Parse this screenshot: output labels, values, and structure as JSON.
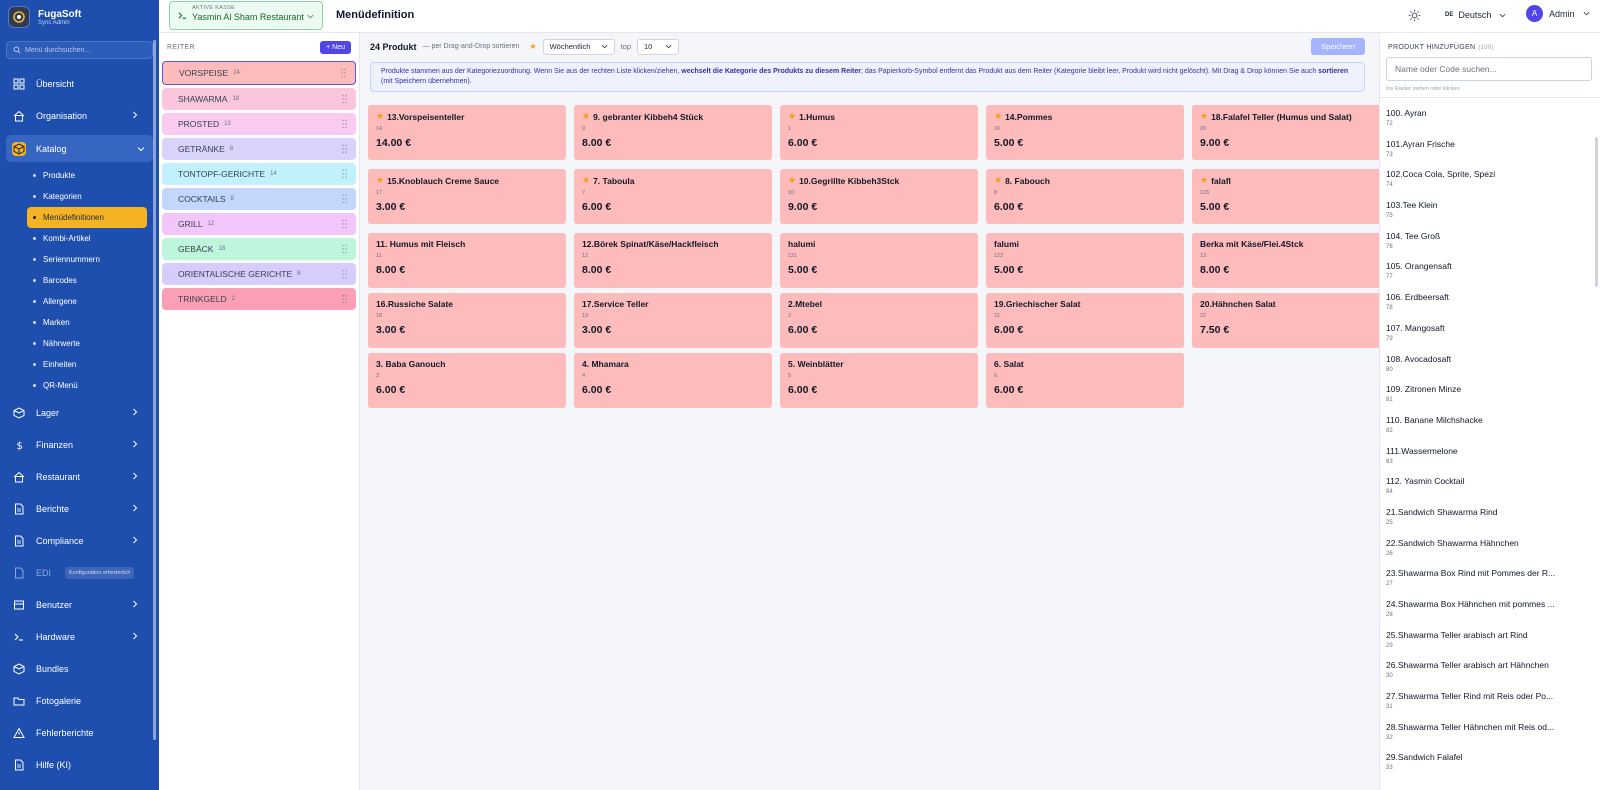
{
  "brand": {
    "title": "FugaSoft",
    "subtitle": "Sync Admin"
  },
  "sidebar": {
    "search_placeholder": "Menü durchsuchen...",
    "items_top": [
      {
        "label": "Übersicht",
        "icon": "dashboard-icon"
      },
      {
        "label": "Organisation",
        "icon": "home-icon"
      },
      {
        "label": "Katalog",
        "icon": "box-icon"
      }
    ],
    "catalog_sub": [
      {
        "label": "Produkte"
      },
      {
        "label": "Kategorien"
      },
      {
        "label": "Menüdefinitionen"
      },
      {
        "label": "Kombi-Artikel"
      },
      {
        "label": "Seriennummern"
      },
      {
        "label": "Barcodes"
      },
      {
        "label": "Allergene"
      },
      {
        "label": "Marken"
      },
      {
        "label": "Nährwerte"
      },
      {
        "label": "Einheiten"
      },
      {
        "label": "QR-Menü"
      }
    ],
    "items_bottom": [
      {
        "label": "Lager"
      },
      {
        "label": "Finanzen"
      },
      {
        "label": "Restaurant"
      },
      {
        "label": "Berichte"
      },
      {
        "label": "Compliance"
      },
      {
        "label": "EDI",
        "badge": "Konfiguration erforderlich"
      },
      {
        "label": "Benutzer"
      },
      {
        "label": "Hardware"
      },
      {
        "label": "Bundles"
      },
      {
        "label": "Fotogalerie"
      },
      {
        "label": "Fehlerberichte"
      },
      {
        "label": "Hilfe (KI)"
      }
    ]
  },
  "topbar": {
    "kasse_label": "AKTIVE KASSE",
    "kasse_value": "Yasmin Al Sham Restaurant",
    "page_title": "Menüdefinition",
    "lang_code": "DE",
    "lang_label": "Deutsch",
    "avatar_letter": "A",
    "user_label": "Admin"
  },
  "reiter": {
    "label": "REITER",
    "new_button": "+ Neu",
    "tabs": [
      {
        "name": "VORSPEISE",
        "count": "24",
        "color": "#fdbbbb"
      },
      {
        "name": "SHAWARMA",
        "count": "18",
        "color": "#fbc5dd"
      },
      {
        "name": "PROSTED",
        "count": "13",
        "color": "#fbcaf0"
      },
      {
        "name": "GETRÄNKE",
        "count": "8",
        "color": "#d9d2fb"
      },
      {
        "name": "TONTOPF-GERICHTE",
        "count": "14",
        "color": "#c1f1fc"
      },
      {
        "name": "COCKTAILS",
        "count": "8",
        "color": "#c3d6fc"
      },
      {
        "name": "GRILL",
        "count": "12",
        "color": "#f2c5fb"
      },
      {
        "name": "GEBÄCK",
        "count": "18",
        "color": "#bdf6dc"
      },
      {
        "name": "ORIENTALISCHE GERICHTE",
        "count": "8",
        "color": "#d7cdfc"
      },
      {
        "name": "TRINKGELD",
        "count": "2",
        "color": "#fb9fb4"
      }
    ]
  },
  "toolbar": {
    "count": "24 Produkt",
    "hint": "— per Drag-and-Drop sortieren",
    "period": "Wöchentlich",
    "top_label": "top",
    "top_value": "10",
    "save": "Speichern"
  },
  "info": {
    "part1": "Produkte stammen aus der Kategoriezuordnung. Wenn Sie aus der rechten Liste klicken/ziehen, ",
    "bold1": "wechselt die Kategorie des Produkts zu diesem Reiter",
    "part2": "; das Papierkorb-Symbol entfernt das Produkt aus dem Reiter (Kategorie bleibt leer, Produkt wird nicht gelöscht). Mit Drag & Drop können Sie auch ",
    "bold2": "sortieren",
    "part3": " (mit Speichern übernehmen)."
  },
  "products": [
    {
      "name": "13.Vorspeisenteller",
      "id": "14",
      "price": "14.00 €",
      "star": true
    },
    {
      "name": "9. gebranter Kibbeh4 Stück",
      "id": "9",
      "price": "8.00 €",
      "star": true
    },
    {
      "name": "1.Humus",
      "id": "1",
      "price": "6.00 €",
      "star": true
    },
    {
      "name": "14.Pommes",
      "id": "16",
      "price": "5.00 €",
      "star": true
    },
    {
      "name": "18.Falafel Teller (Humus und Salat)",
      "id": "20",
      "price": "9.00 €",
      "star": true
    },
    {
      "name": "15.Knoblauch Creme Sauce",
      "id": "17",
      "price": "3.00 €",
      "star": true
    },
    {
      "name": "7. Taboula",
      "id": "7",
      "price": "6.00 €",
      "star": true
    },
    {
      "name": "10.Gegrillte Kibbeh3Stck",
      "id": "10",
      "price": "9.00 €",
      "star": true
    },
    {
      "name": "8. Fabouch",
      "id": "8",
      "price": "6.00 €",
      "star": true
    },
    {
      "name": "falafl",
      "id": "126",
      "price": "5.00 €",
      "star": true
    },
    {
      "name": "11. Humus mit Fleisch",
      "id": "11",
      "price": "8.00 €",
      "star": false
    },
    {
      "name": "12.Börek Spinat/Käse/Hackfleisch",
      "id": "12",
      "price": "8.00 €",
      "star": false
    },
    {
      "name": "halumi",
      "id": "121",
      "price": "5.00 €",
      "star": false
    },
    {
      "name": "falumi",
      "id": "122",
      "price": "5.00 €",
      "star": false
    },
    {
      "name": "Berka mit Käse/Flei.4Stck",
      "id": "13",
      "price": "8.00 €",
      "star": false
    },
    {
      "name": "16.Russiche Salate",
      "id": "18",
      "price": "3.00 €",
      "star": false
    },
    {
      "name": "17.Service Teller",
      "id": "19",
      "price": "3.00 €",
      "star": false
    },
    {
      "name": "2.Mtebel",
      "id": "2",
      "price": "6.00 €",
      "star": false
    },
    {
      "name": "19.Griechischer Salat",
      "id": "21",
      "price": "6.00 €",
      "star": false
    },
    {
      "name": "20.Hähnchen Salat",
      "id": "22",
      "price": "7.50 €",
      "star": false
    },
    {
      "name": "3. Baba Ganouch",
      "id": "3",
      "price": "6.00 €",
      "star": false
    },
    {
      "name": "4. Mhamara",
      "id": "4",
      "price": "6.00 €",
      "star": false
    },
    {
      "name": "5. Weinblätter",
      "id": "5",
      "price": "6.00 €",
      "star": false
    },
    {
      "name": "6. Salat",
      "id": "6",
      "price": "6.00 €",
      "star": false
    }
  ],
  "right": {
    "header": "PRODUKT HINZUFÜGEN",
    "count": "(100)",
    "placeholder": "Name oder Code suchen...",
    "hint": "Ins Raster ziehen oder klicken",
    "items": [
      {
        "name": "100. Ayran",
        "id": "72"
      },
      {
        "name": "101.Ayran Frische",
        "id": "73"
      },
      {
        "name": "102.Coca Cola, Sprite, Spezi",
        "id": "74"
      },
      {
        "name": "103.Tee Klein",
        "id": "75"
      },
      {
        "name": "104. Tee Groß",
        "id": "76"
      },
      {
        "name": "105. Orangensaft",
        "id": "77"
      },
      {
        "name": "106. Erdbeersaft",
        "id": "78"
      },
      {
        "name": "107. Mangosaft",
        "id": "79"
      },
      {
        "name": "108. Avocadosaft",
        "id": "80"
      },
      {
        "name": "109. Zitronen Minze",
        "id": "81"
      },
      {
        "name": "110. Banane Milchshacke",
        "id": "82"
      },
      {
        "name": "111.Wassermelone",
        "id": "83"
      },
      {
        "name": "112. Yasmin Cocktail",
        "id": "84"
      },
      {
        "name": "21.Sandwich Shawarma Rind",
        "id": "25"
      },
      {
        "name": "22.Sandwich Shawarma Hähnchen",
        "id": "26"
      },
      {
        "name": "23.Shawarma Box Rind mit Pommes der R...",
        "id": "27"
      },
      {
        "name": "24.Shawarma Box Hähnchen mit pommes ...",
        "id": "28"
      },
      {
        "name": "25.Shawarma Teller arabisch art Rind",
        "id": "29"
      },
      {
        "name": "26.Shawarma Teller arabisch art Hähnchen",
        "id": "30"
      },
      {
        "name": "27.Shawarma Teller Rind mit Reis oder Po...",
        "id": "31"
      },
      {
        "name": "28.Shawarma Teller Hähnchen mit Reis od...",
        "id": "32"
      },
      {
        "name": "29.Sandwich Falafel",
        "id": "33"
      }
    ]
  }
}
